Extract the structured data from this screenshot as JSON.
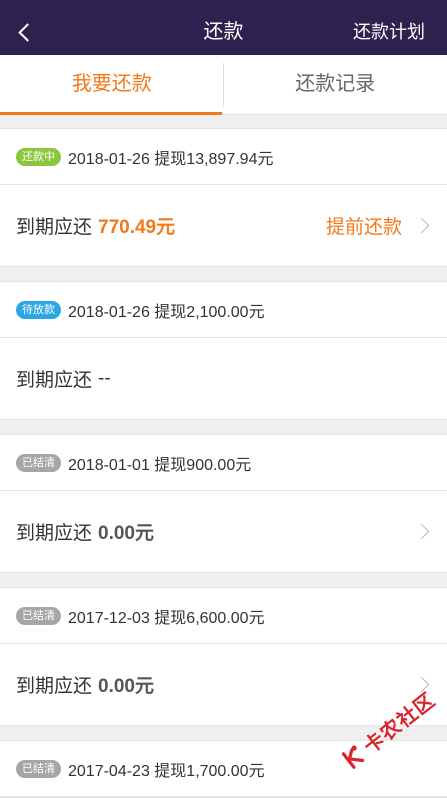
{
  "colors": {
    "nav_bg": "#2d2150",
    "accent": "#f07a1c",
    "page_bg": "#efefef",
    "settled_amount": "#555555",
    "watermark": "#d9232d"
  },
  "icons": {
    "back": "chevron-left-icon",
    "row_arrow": "chevron-right-icon",
    "watermark_logo": "kanong-logo-icon"
  },
  "nav": {
    "title": "还款",
    "right_action": "还款计划"
  },
  "tabs": [
    {
      "label": "我要还款",
      "active": true
    },
    {
      "label": "还款记录",
      "active": false
    }
  ],
  "records": [
    {
      "status": "还款中",
      "status_color": "#8cc63e",
      "summary": "2018-01-26 提现13,897.94元",
      "due_label": "到期应还",
      "due_amount": "770.49元",
      "action": "提前还款"
    },
    {
      "status": "待放款",
      "status_color": "#2ba6e1",
      "summary": "2018-01-26 提现2,100.00元",
      "due_label": "到期应还",
      "due_amount": "--"
    },
    {
      "status": "已结清",
      "status_color": "#a6a6a6",
      "summary": "2018-01-01 提现900.00元",
      "due_label": "到期应还",
      "due_amount": "0.00元"
    },
    {
      "status": "已结清",
      "status_color": "#a6a6a6",
      "summary": "2017-12-03 提现6,600.00元",
      "due_label": "到期应还",
      "due_amount": "0.00元"
    },
    {
      "status": "已结清",
      "status_color": "#a6a6a6",
      "summary": "2017-04-23 提现1,700.00元"
    }
  ],
  "watermark": {
    "text": "卡农社区"
  }
}
